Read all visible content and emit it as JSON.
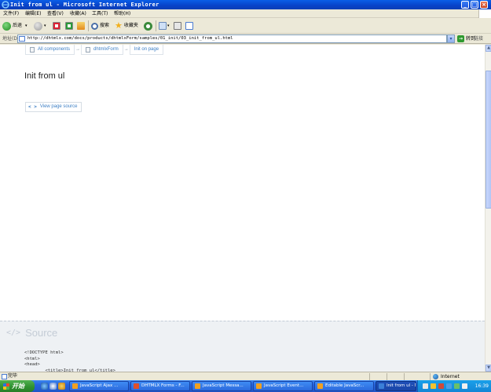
{
  "window": {
    "title": "Init from ul - Microsoft Internet Explorer",
    "buttons": {
      "minimize": "_",
      "maximize": "□",
      "close": "×"
    }
  },
  "menu": [
    "文件(F)",
    "编辑(E)",
    "查看(V)",
    "收藏(A)",
    "工具(T)",
    "帮助(H)"
  ],
  "toolbar": {
    "back_label": "后退",
    "search_label": "搜索",
    "favorites_label": "收藏夹"
  },
  "address": {
    "label": "地址(D)",
    "url": "http://dhtmlx.com/docs/products/dhtmlxForm/samples/01_init/03_init_from_ul.html",
    "go_label": "转到",
    "links_label": "链接"
  },
  "page": {
    "breadcrumbs": [
      "All components",
      "dhtmlxForm",
      "Init on page"
    ],
    "breadcrumb_separator": "→",
    "heading": "Init from ul",
    "view_source_icon": "< >",
    "view_source_label": "View page source",
    "source_icon": "</>",
    "source_title": "Source",
    "source_code": "<!DOCTYPE html>\n<html>\n<head>\n\t<title>Init from ul</title>"
  },
  "status": {
    "text": "完毕",
    "zone": "Internet"
  },
  "taskbar": {
    "start_label": "开始",
    "tasks": [
      {
        "label": "JavaScript Ajax ...",
        "icon_color": "#f0a020",
        "active": false
      },
      {
        "label": "DHTMLX Forms - F...",
        "icon_color": "#e0502a",
        "active": false
      },
      {
        "label": "JavaScript Messa...",
        "icon_color": "#f0a020",
        "active": false
      },
      {
        "label": "JavaScript Event...",
        "icon_color": "#f0a020",
        "active": false
      },
      {
        "label": "Editable JavaScr...",
        "icon_color": "#f0a020",
        "active": false
      },
      {
        "label": "Init from ul - M...",
        "icon_color": "#3a7fd8",
        "active": true
      }
    ],
    "clock": "16:39"
  },
  "colors": {
    "link": "#3d7fc4",
    "source_panel_bg": "#eef1f4",
    "titlebar": "#0842c8"
  }
}
